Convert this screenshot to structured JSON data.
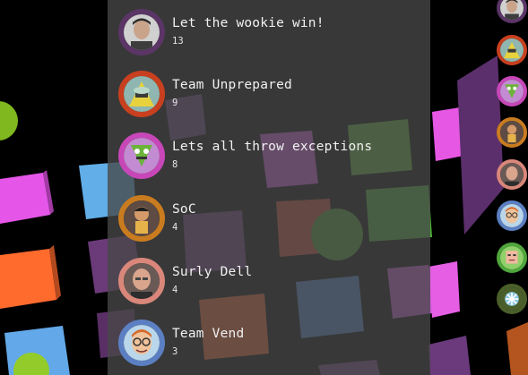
{
  "leaderboard": {
    "entries": [
      {
        "name": "Let the wookie win!",
        "score": "13",
        "ring_color": "#5a3566",
        "avatar": "man-dark-hair-photo"
      },
      {
        "name": "Team Unprepared",
        "score": "9",
        "ring_color": "#c8401f",
        "avatar": "alien-cartoon"
      },
      {
        "name": "Lets all throw exceptions",
        "score": "8",
        "ring_color": "#c847b8",
        "avatar": "green-robot-cartoon"
      },
      {
        "name": "SoC",
        "score": "4",
        "ring_color": "#c97c1f",
        "avatar": "cartoon-character"
      },
      {
        "name": "Surly Dell",
        "score": "4",
        "ring_color": "#d9877a",
        "avatar": "bald-man-photo"
      },
      {
        "name": "Team Vend",
        "score": "3",
        "ring_color": "#5b7fc2",
        "avatar": "cartoon-man-glasses"
      }
    ]
  },
  "sidebar": {
    "avatars": [
      {
        "ring_color": "#5a3566",
        "avatar": "man-dark-hair-photo"
      },
      {
        "ring_color": "#c8401f",
        "avatar": "alien-cartoon"
      },
      {
        "ring_color": "#c847b8",
        "avatar": "green-robot-cartoon"
      },
      {
        "ring_color": "#c97c1f",
        "avatar": "cartoon-character"
      },
      {
        "ring_color": "#d9877a",
        "avatar": "bald-man-photo"
      },
      {
        "ring_color": "#5b7fc2",
        "avatar": "cartoon-man-glasses"
      },
      {
        "ring_color": "#4fa63c",
        "avatar": "pixel-face"
      },
      {
        "ring_color": "#4a5f2a",
        "avatar": "snowflake"
      }
    ]
  }
}
